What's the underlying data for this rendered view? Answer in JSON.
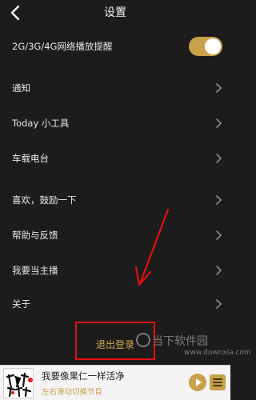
{
  "nav": {
    "title": "设置"
  },
  "rows": [
    {
      "label": "2G/3G/4G网络播放提醒"
    },
    {
      "label": "通知"
    },
    {
      "label": "Today 小工具"
    },
    {
      "label": "车载电台"
    },
    {
      "label": "喜欢，鼓励一下"
    },
    {
      "label": "帮助与反馈"
    },
    {
      "label": "我要当主播"
    },
    {
      "label": "关于"
    }
  ],
  "network_toggle": {
    "on": true
  },
  "logout": {
    "label": "退出登录"
  },
  "player": {
    "song": "我要像果仁一样活净",
    "hint": "左右滑动切换节目"
  },
  "watermark": {
    "text": "当下软件园",
    "sub": "www.downxia.com"
  },
  "colors": {
    "accent": "#c9a14b",
    "background": "#1c1c1c",
    "annotation": "#e01010"
  }
}
